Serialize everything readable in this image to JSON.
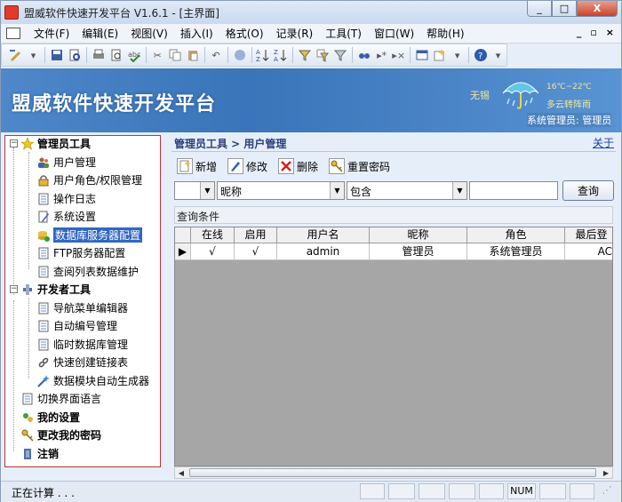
{
  "window": {
    "title": "盟威软件快速开发平台 V1.6.1 - [主界面]",
    "minimize_label": "_",
    "maximize_label": "□",
    "close_label": "X"
  },
  "menubar": {
    "items": [
      "文件(F)",
      "编辑(E)",
      "视图(V)",
      "插入(I)",
      "格式(O)",
      "记录(R)",
      "工具(T)",
      "窗口(W)",
      "帮助(H)"
    ],
    "mdi_min": "_",
    "mdi_restore": "▫",
    "mdi_close": "×"
  },
  "banner": {
    "title": "盟威软件快速开发平台",
    "weather_city": "无锡",
    "weather_temp": "16℃~22℃",
    "weather_desc": "多云转阵雨",
    "role_label": "系统管理员: 管理员",
    "colors": {
      "sky": "#4e88c9",
      "accent_text": "#f3e79a"
    }
  },
  "sidebar": {
    "groups": [
      {
        "label": "管理员工具",
        "icon": "star-icon",
        "expanded": true,
        "items": [
          {
            "label": "用户管理",
            "icon": "users-icon"
          },
          {
            "label": "用户角色/权限管理",
            "icon": "lock-icon"
          },
          {
            "label": "操作日志",
            "icon": "document-icon"
          },
          {
            "label": "系统设置",
            "icon": "document-edit-icon"
          },
          {
            "label": "数据库服务器配置",
            "icon": "database-server-icon",
            "selected": true
          },
          {
            "label": "FTP服务器配置",
            "icon": "document-icon"
          },
          {
            "label": "查阅列表数据维护",
            "icon": "document-icon"
          }
        ]
      },
      {
        "label": "开发者工具",
        "icon": "tools-icon",
        "expanded": true,
        "items": [
          {
            "label": "导航菜单编辑器",
            "icon": "document-icon"
          },
          {
            "label": "自动编号管理",
            "icon": "document-icon"
          },
          {
            "label": "临时数据库管理",
            "icon": "document-icon"
          },
          {
            "label": "快速创建链接表",
            "icon": "link-icon"
          },
          {
            "label": "数据模块自动生成器",
            "icon": "wizard-icon"
          }
        ]
      }
    ],
    "top_items": [
      {
        "label": "切换界面语言",
        "icon": "document-icon",
        "bold": false
      },
      {
        "label": "我的设置",
        "icon": "settings-icon",
        "bold": true
      },
      {
        "label": "更改我的密码",
        "icon": "key-icon",
        "bold": true
      },
      {
        "label": "注销",
        "icon": "logout-icon",
        "bold": true
      }
    ]
  },
  "main": {
    "breadcrumb": "管理员工具 > 用户管理",
    "about_link": "关于",
    "actions": [
      {
        "label": "新增",
        "icon": "new-icon"
      },
      {
        "label": "修改",
        "icon": "edit-icon"
      },
      {
        "label": "删除",
        "icon": "delete-icon"
      },
      {
        "label": "重置密码",
        "icon": "key-icon"
      }
    ],
    "filter": {
      "field1_value": "",
      "field2_value": "昵称",
      "operator_value": "包含",
      "search_value": "",
      "query_button": "查询"
    },
    "condition_label": "查询条件",
    "grid": {
      "columns": [
        "在线",
        "启用",
        "用户名",
        "昵称",
        "角色",
        "最后登"
      ],
      "rows": [
        [
          "√",
          "√",
          "admin",
          "管理员",
          "系统管理员",
          "AC"
        ]
      ]
    }
  },
  "statusbar": {
    "text": "正在计算 . . .",
    "num_label": "NUM"
  }
}
